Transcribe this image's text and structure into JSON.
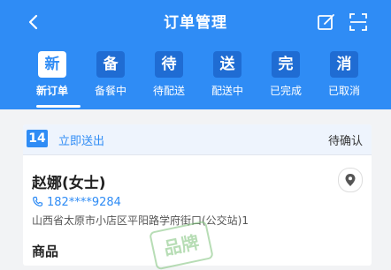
{
  "header": {
    "title": "订单管理"
  },
  "tabs": [
    {
      "badge": "新",
      "label": "新订单",
      "active": true
    },
    {
      "badge": "备",
      "label": "备餐中"
    },
    {
      "badge": "待",
      "label": "待配送"
    },
    {
      "badge": "送",
      "label": "配送中"
    },
    {
      "badge": "完",
      "label": "已完成"
    },
    {
      "badge": "消",
      "label": "已取消"
    }
  ],
  "order": {
    "number": "14",
    "delivery_type": "立即送出",
    "status": "待确认",
    "customer_name": "赵娜(女士)",
    "phone": "182****9284",
    "address": "山西省太原市小店区平阳路学府街口(公交站)1",
    "next_row": "商品"
  },
  "overlay": {
    "stamp": "品牌"
  },
  "colors": {
    "primary": "#2f8cf5",
    "dark_badge": "#1f6cd3",
    "background": "#f2f3f5"
  },
  "icons": {
    "back": "back-arrow-icon",
    "edit": "edit-icon",
    "scan": "scan-icon",
    "phone": "phone-icon",
    "location": "location-pin-icon"
  }
}
